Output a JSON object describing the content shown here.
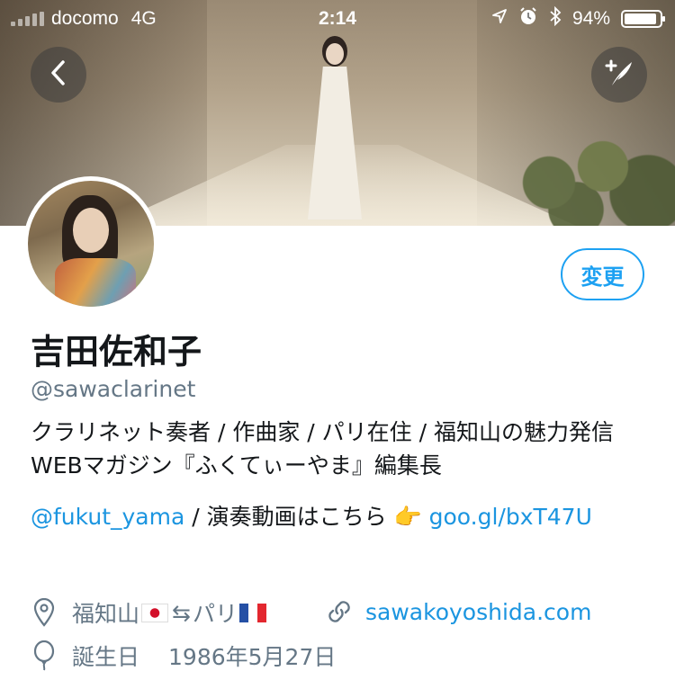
{
  "status_bar": {
    "carrier": "docomo",
    "network": "4G",
    "time": "2:14",
    "battery": "94%",
    "battery_level": 0.94
  },
  "header": {
    "edit_button_label": "変更"
  },
  "profile": {
    "display_name": "吉田佐和子",
    "handle": "@sawaclarinet",
    "bio": "クラリネット奏者 / 作曲家 / パリ在住 / 福知山の魅力発信WEBマガジン『ふくてぃーやま』編集長",
    "mention": "@fukut_yama",
    "link_prefix_text": " / 演奏動画はこちら 👉 ",
    "short_link": "goo.gl/bxT47U",
    "location_from": "福知山",
    "location_arrow": "⇆",
    "location_to": "パリ",
    "website": "sawakoyoshida.com",
    "birthday_label": "誕生日",
    "birthday_value": "1986年5月27日"
  },
  "icons": {
    "back": "chevron-left-icon",
    "compose": "feather-plus-icon",
    "location": "map-pin-icon",
    "website": "link-icon",
    "birthday": "balloon-icon",
    "alarm": "alarm-icon",
    "bluetooth": "bluetooth-icon",
    "navigation": "location-arrow-icon"
  },
  "colors": {
    "accent": "#1da1f2",
    "link": "#1b95e0",
    "secondary_text": "#657786",
    "primary_text": "#14171a"
  }
}
